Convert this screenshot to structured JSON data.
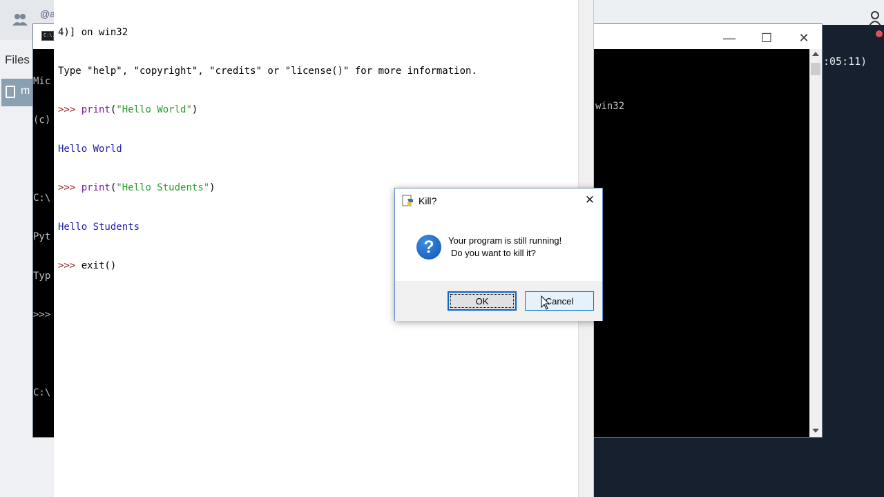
{
  "background_app": {
    "files_label": "Files",
    "mention_text": "@a",
    "file_item_label": "m",
    "timestamp_fragment": ":05:11)"
  },
  "console": {
    "title_icon_text": "C:\\.",
    "minimize_glyph": "—",
    "maximize_glyph": "☐",
    "close_glyph": "✕",
    "lines": [
      "Mic",
      "(c)",
      "",
      "C:\\",
      "Pyt",
      "Typ",
      ">>>",
      "",
      "C:\\"
    ],
    "right_text": "win32"
  },
  "shell": {
    "line1": "4)] on win32",
    "line2": "Type \"help\", \"copyright\", \"credits\" or \"license()\" for more information.",
    "prompt": ">>> ",
    "cmd1_func": "print",
    "cmd1_open": "(",
    "cmd1_arg": "\"Hello World\"",
    "cmd1_close": ")",
    "out1": "Hello World",
    "cmd2_func": "print",
    "cmd2_open": "(",
    "cmd2_arg": "\"Hello Students\"",
    "cmd2_close": ")",
    "out2": "Hello Students",
    "cmd3": "exit()"
  },
  "dialog": {
    "title": "Kill?",
    "close_glyph": "✕",
    "icon_glyph": "?",
    "message_line1": "Your program is still running!",
    "message_line2": "Do you want to kill it?",
    "ok_label": "OK",
    "cancel_label": "Cancel"
  },
  "colors": {
    "prompt": "#8a1c1c",
    "string": "#26a026",
    "output": "#1c1cb0",
    "dialog_border": "#5b8ac9",
    "question_icon": "#1356b4",
    "background_dark": "#17202e"
  }
}
